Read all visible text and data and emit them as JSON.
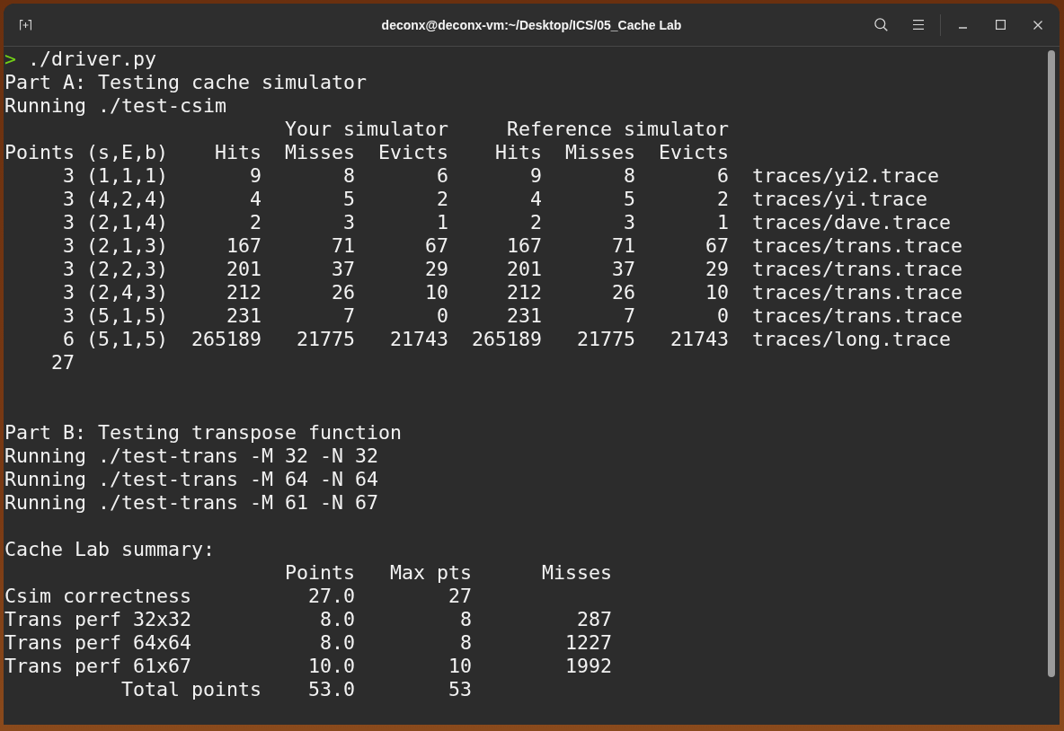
{
  "window": {
    "title": "deconx@deconx-vm:~/Desktop/ICS/05_Cache Lab"
  },
  "terminal": {
    "prompt": {
      "symbol": ">",
      "command": "./driver.py"
    },
    "part_a": {
      "heading": "Part A: Testing cache simulator",
      "command": "Running ./test-csim",
      "column_groups": [
        "Your simulator",
        "Reference simulator"
      ],
      "columns": [
        "Points",
        "(s,E,b)",
        "Hits",
        "Misses",
        "Evicts",
        "Hits",
        "Misses",
        "Evicts"
      ],
      "rows": [
        [
          "3",
          "(1,1,1)",
          "9",
          "8",
          "6",
          "9",
          "8",
          "6",
          "traces/yi2.trace"
        ],
        [
          "3",
          "(4,2,4)",
          "4",
          "5",
          "2",
          "4",
          "5",
          "2",
          "traces/yi.trace"
        ],
        [
          "3",
          "(2,1,4)",
          "2",
          "3",
          "1",
          "2",
          "3",
          "1",
          "traces/dave.trace"
        ],
        [
          "3",
          "(2,1,3)",
          "167",
          "71",
          "67",
          "167",
          "71",
          "67",
          "traces/trans.trace"
        ],
        [
          "3",
          "(2,2,3)",
          "201",
          "37",
          "29",
          "201",
          "37",
          "29",
          "traces/trans.trace"
        ],
        [
          "3",
          "(2,4,3)",
          "212",
          "26",
          "10",
          "212",
          "26",
          "10",
          "traces/trans.trace"
        ],
        [
          "3",
          "(5,1,5)",
          "231",
          "7",
          "0",
          "231",
          "7",
          "0",
          "traces/trans.trace"
        ],
        [
          "6",
          "(5,1,5)",
          "265189",
          "21775",
          "21743",
          "265189",
          "21775",
          "21743",
          "traces/long.trace"
        ]
      ],
      "total": "27"
    },
    "part_b": {
      "heading": "Part B: Testing transpose function",
      "commands": [
        "Running ./test-trans -M 32 -N 32",
        "Running ./test-trans -M 64 -N 64",
        "Running ./test-trans -M 61 -N 67"
      ]
    },
    "summary": {
      "heading": "Cache Lab summary:",
      "columns": [
        "Points",
        "Max pts",
        "Misses"
      ],
      "rows": [
        {
          "label": "Csim correctness",
          "points": "27.0",
          "max_pts": "27"
        },
        {
          "label": "Trans perf 32x32",
          "points": "8.0",
          "max_pts": "8",
          "misses": "287"
        },
        {
          "label": "Trans perf 64x64",
          "points": "8.0",
          "max_pts": "8",
          "misses": "1227"
        },
        {
          "label": "Trans perf 61x67",
          "points": "10.0",
          "max_pts": "10",
          "misses": "1992"
        }
      ],
      "total": {
        "label": "Total points",
        "points": "53.0",
        "max_pts": "53"
      }
    }
  }
}
